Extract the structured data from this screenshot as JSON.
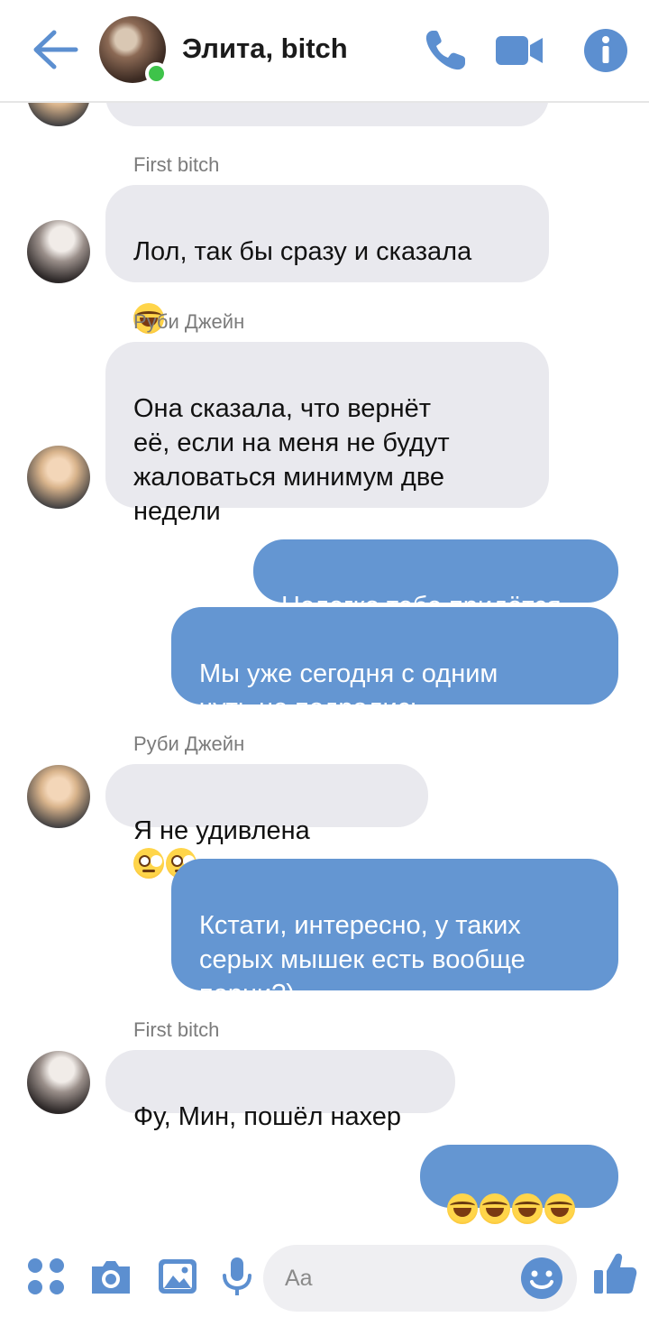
{
  "header": {
    "title": "Элита, bitch",
    "accent_color": "#5c8fd0",
    "online_color": "#3ec34a"
  },
  "messages": [
    {
      "sender": "First bitch",
      "text": "Лол, так бы сразу и сказала",
      "emoji": [
        "face-with-tears-of-joy"
      ]
    },
    {
      "sender": "Руби Джейн",
      "text": "Она сказала, что вернёт\nеё, если на меня не будут\nжаловаться минимум две\nнедели"
    },
    {
      "outgoing": true,
      "text": "Нелегко тебе придётся"
    },
    {
      "outgoing": true,
      "text": "Мы уже сегодня с одним\nчуть не подрались~"
    },
    {
      "sender": "Руби Джейн",
      "text": "Я не удивлена",
      "emoji": [
        "face-with-rolling-eyes",
        "face-with-rolling-eyes"
      ]
    },
    {
      "outgoing": true,
      "text": "Кстати, интересно, у таких\nсерых мышек есть вообще\nпарни?)"
    },
    {
      "sender": "First bitch",
      "text": "Фу, Мин, пошёл нахер"
    },
    {
      "outgoing": true,
      "text": "",
      "emoji": [
        "face-with-tears-of-joy",
        "face-with-tears-of-joy",
        "face-with-tears-of-joy",
        "face-with-tears-of-joy"
      ]
    }
  ],
  "composer": {
    "placeholder": "Aa"
  },
  "colors": {
    "incoming_bubble": "#e9e9ee",
    "outgoing_bubble": "#6496d2"
  }
}
